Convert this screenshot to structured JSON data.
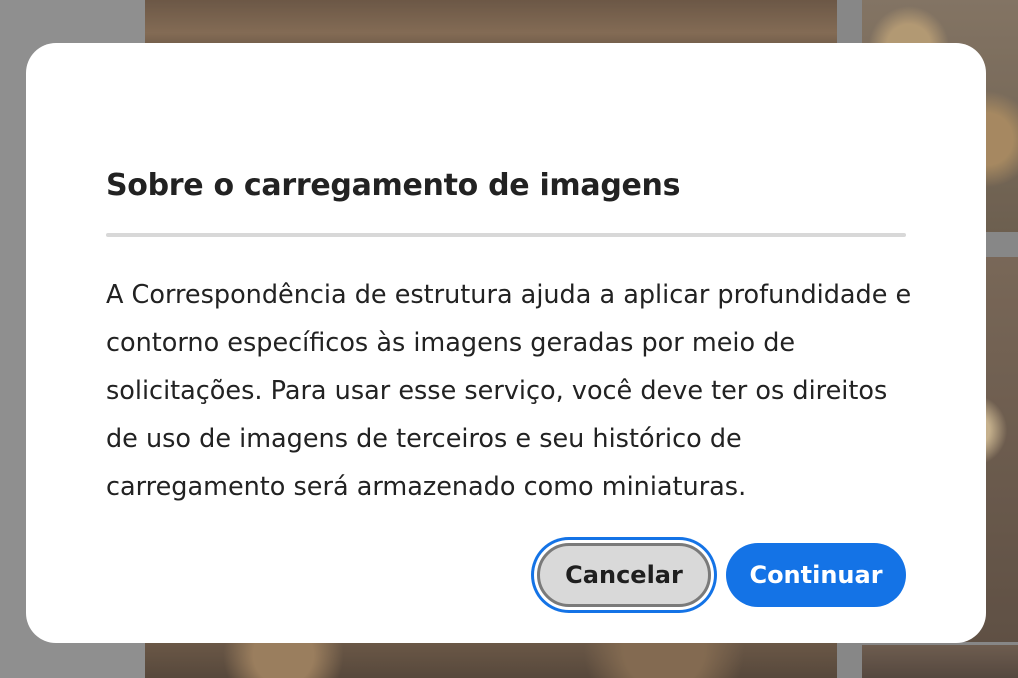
{
  "dialog": {
    "title": "Sobre o carregamento de imagens",
    "body": "A Correspondência de estrutura ajuda a aplicar profundidade e contorno específicos às imagens geradas por meio de solicitações. Para usar esse serviço, você deve ter os direitos de uso de imagens de terceiros e seu histórico de carregamento será armazenado como miniaturas.",
    "buttons": {
      "cancel_label": "Cancelar",
      "continue_label": "Continuar"
    }
  },
  "colors": {
    "accent": "#1473e6",
    "cancel_bg": "#d9d9d9",
    "text": "#222222",
    "dialog_bg": "#ffffff"
  }
}
